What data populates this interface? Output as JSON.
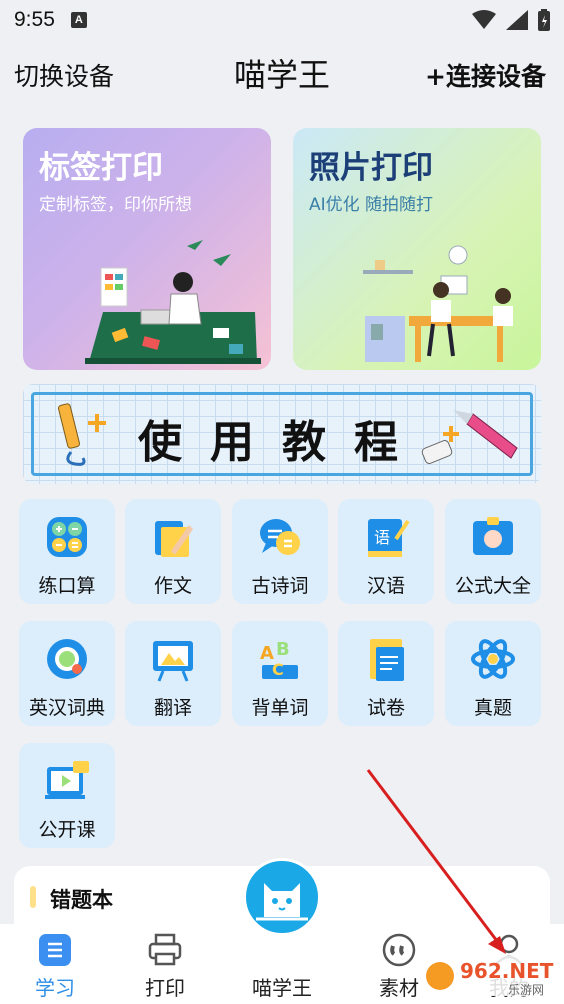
{
  "status": {
    "time": "9:55",
    "badge": "A"
  },
  "header": {
    "left_label": "切换设备",
    "title": "喵学王",
    "right_label": "+连接设备"
  },
  "cards": [
    {
      "title": "标签打印",
      "subtitle": "定制标签，印你所想"
    },
    {
      "title": "照片打印",
      "subtitle": "AI优化 随拍随打"
    }
  ],
  "tutorial": {
    "text": "使用教程"
  },
  "features": [
    {
      "label": "练口算",
      "icon": "calculator-icon"
    },
    {
      "label": "作文",
      "icon": "pen-icon"
    },
    {
      "label": "古诗词",
      "icon": "speech-bubble-icon"
    },
    {
      "label": "汉语",
      "icon": "language-book-icon"
    },
    {
      "label": "公式大全",
      "icon": "id-card-icon"
    },
    {
      "label": "英汉词典",
      "icon": "dictionary-icon"
    },
    {
      "label": "翻译",
      "icon": "translate-board-icon"
    },
    {
      "label": "背单词",
      "icon": "abc-icon"
    },
    {
      "label": "试卷",
      "icon": "exam-paper-icon"
    },
    {
      "label": "真题",
      "icon": "atom-icon"
    },
    {
      "label": "公开课",
      "icon": "video-lesson-icon"
    }
  ],
  "wrong_book": {
    "title": "错题本"
  },
  "nav": [
    {
      "label": "学习",
      "icon": "study-icon",
      "active": true
    },
    {
      "label": "打印",
      "icon": "printer-icon",
      "active": false
    },
    {
      "label": "喵学王",
      "icon": "cat-logo-icon",
      "active": false
    },
    {
      "label": "素材",
      "icon": "quote-icon",
      "active": false
    },
    {
      "label": "我的",
      "icon": "profile-icon",
      "active": false
    }
  ],
  "watermark": {
    "text": "962.NET",
    "subtext": "乐游网"
  },
  "colors": {
    "accent": "#2f8fe6",
    "tile_bg": "#dceefc",
    "center_button": "#1aa8e6"
  }
}
